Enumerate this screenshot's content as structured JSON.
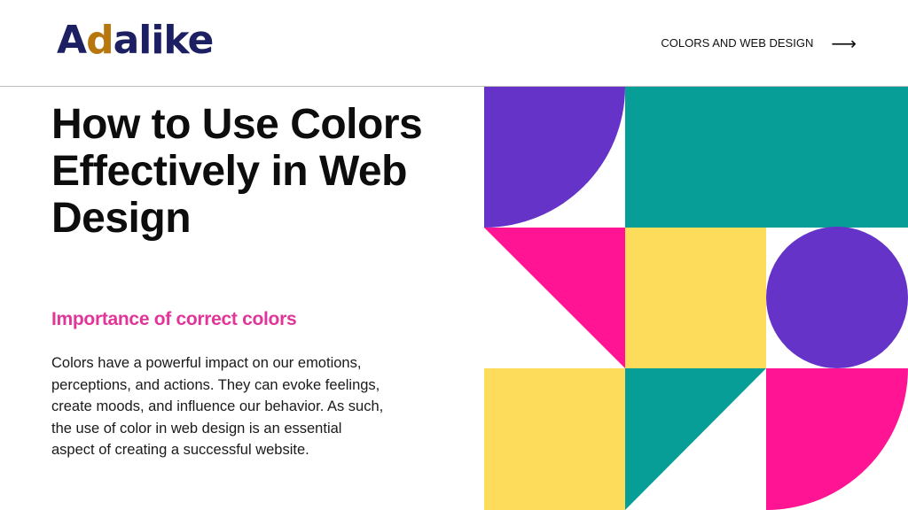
{
  "header": {
    "logo_first": "A",
    "logo_accent": "d",
    "logo_rest": "alike",
    "nav_label": "COLORS AND WEB DESIGN",
    "nav_icon": "arrow-right-icon"
  },
  "hero": {
    "title": "How to Use Colors Effectively in Web Design",
    "subheading": "Importance of correct colors",
    "body": "Colors have a powerful impact on our emotions, perceptions, and actions. They can evoke feelings, create moods, and influence our behavior. As such, the use of color in web design is an essential aspect of creating a successful website."
  },
  "colors": {
    "logo_navy": "#1c2062",
    "logo_gold": "#b8760f",
    "purple": "#6633c8",
    "teal": "#079e97",
    "magenta": "#ff1493",
    "yellow": "#fddc5c",
    "subheading_pink": "#e1359a"
  }
}
